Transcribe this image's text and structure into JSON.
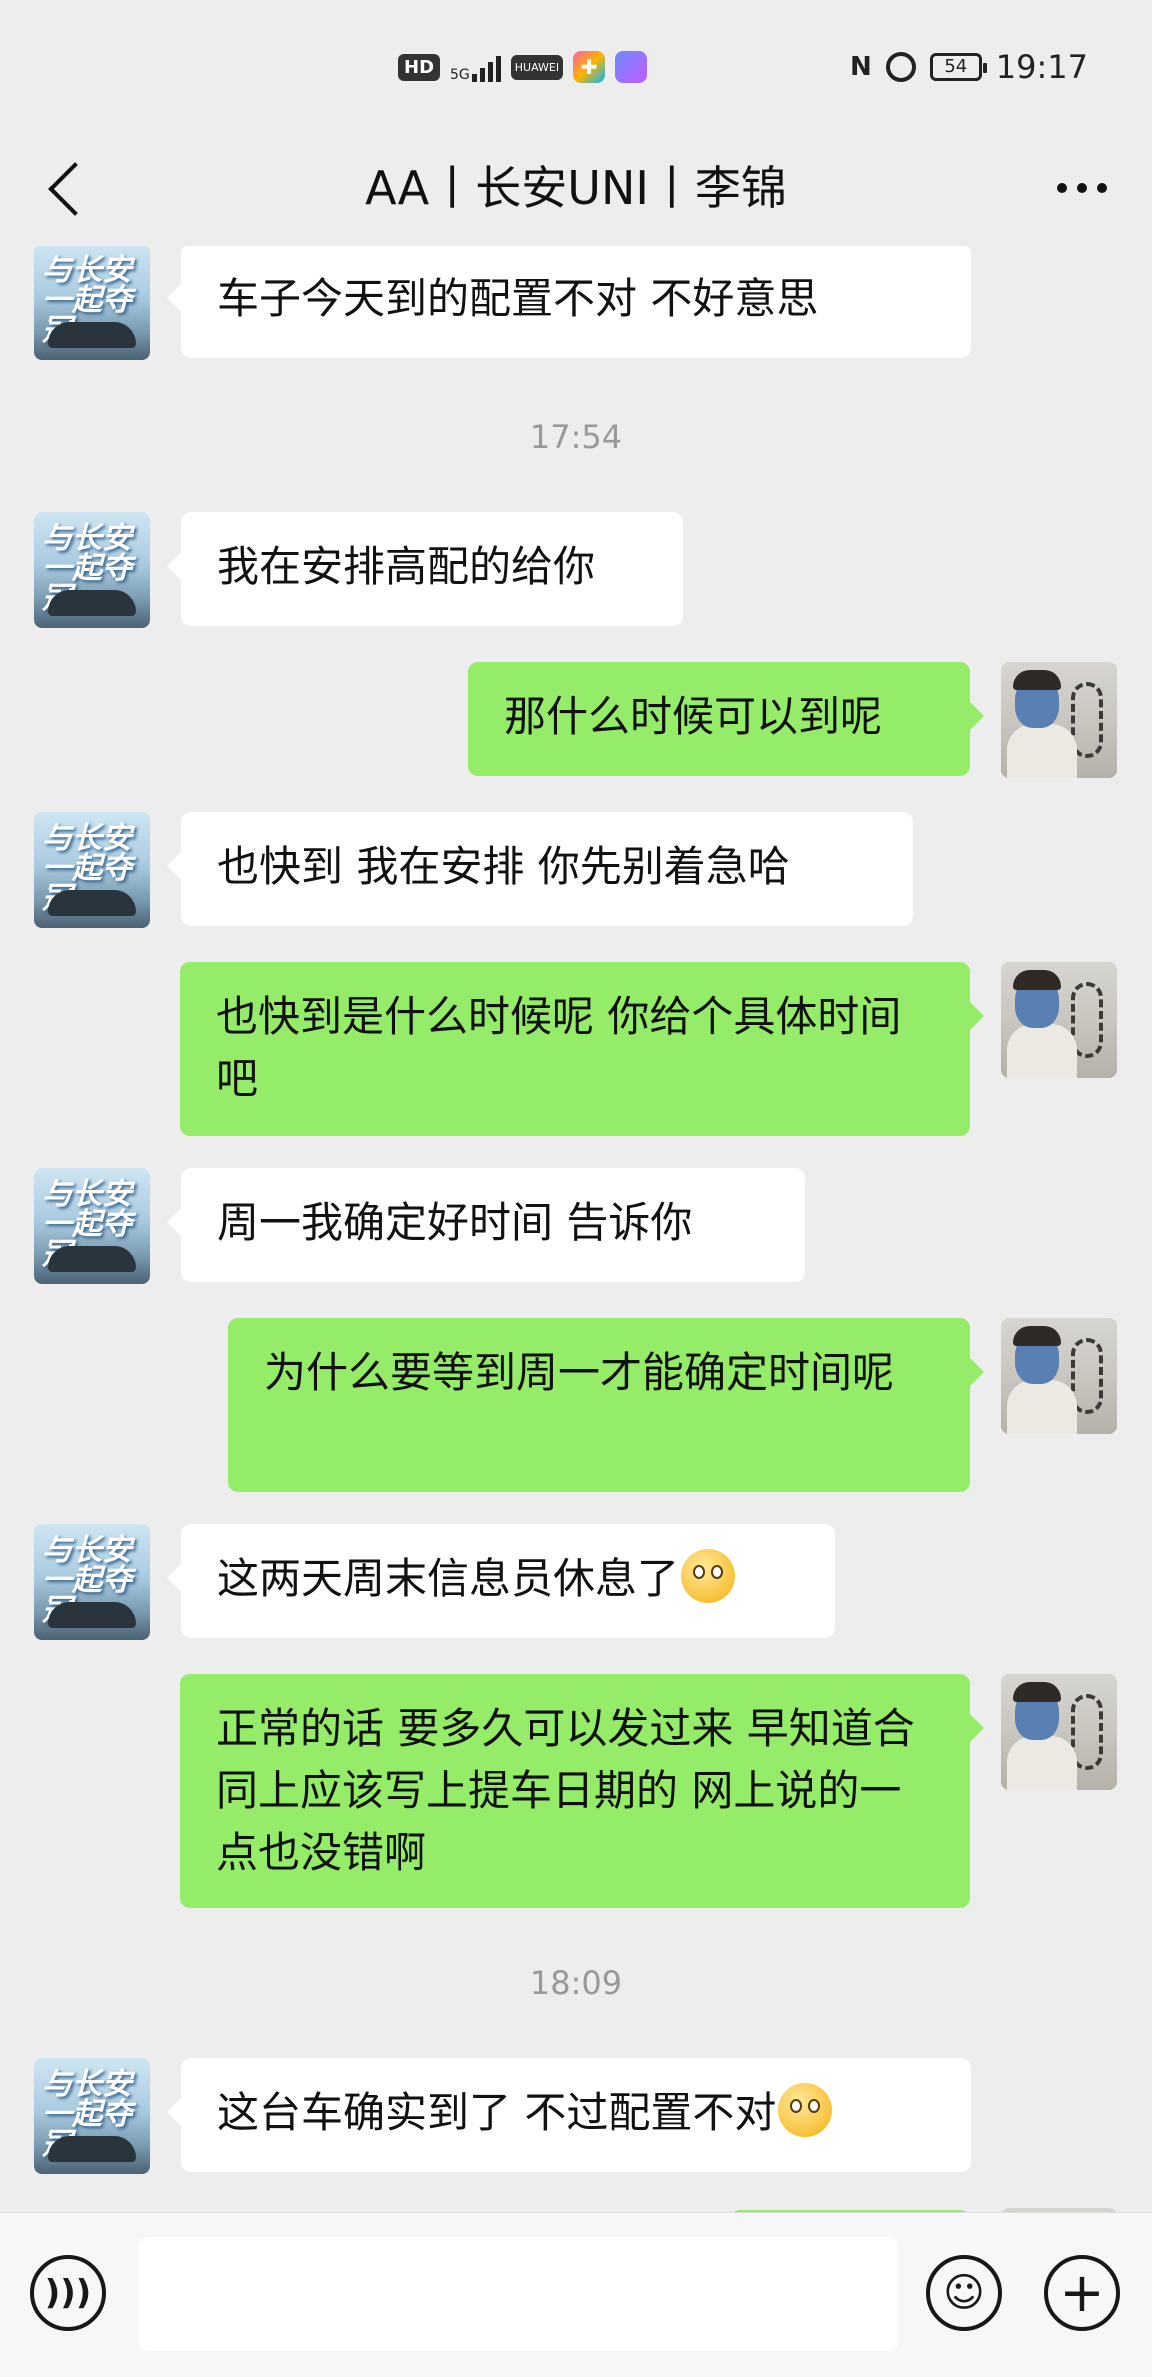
{
  "status_bar": {
    "hd": "HD",
    "network": "5G",
    "brand": "HUAWEI",
    "nfc": "N",
    "battery": "54",
    "time": "19:17"
  },
  "header": {
    "title": "AA丨长安UNI丨李锦",
    "back_icon": "chevron-left-icon",
    "more_icon": "more-dots-icon"
  },
  "avatar_left": {
    "caption": "与长安\n一起夺冠"
  },
  "messages": [
    {
      "type": "msg",
      "side": "left",
      "text": "车子今天到的配置不对  不好意思"
    },
    {
      "type": "time",
      "text": "17:54"
    },
    {
      "type": "msg",
      "side": "left",
      "text": "我在安排高配的给你"
    },
    {
      "type": "msg",
      "side": "right",
      "text": "那什么时候可以到呢"
    },
    {
      "type": "msg",
      "side": "left",
      "text": "也快到  我在安排 你先别着急哈"
    },
    {
      "type": "msg",
      "side": "right",
      "text": "也快到是什么时候呢    你给个具体时间吧"
    },
    {
      "type": "msg",
      "side": "left",
      "text": "周一我确定好时间  告诉你"
    },
    {
      "type": "msg",
      "side": "right",
      "text": "为什么要等到周一才能确定时间呢"
    },
    {
      "type": "msg",
      "side": "left",
      "text": "这两天周末信息员休息了",
      "emoji": "flushed-face-emoji"
    },
    {
      "type": "msg",
      "side": "right",
      "text": "正常的话  要多久可以发过来   早知道合同上应该写上提车日期的    网上说的一点也没错啊"
    },
    {
      "type": "time",
      "text": "18:09"
    },
    {
      "type": "msg",
      "side": "left",
      "text": "这台车确实到了  不过配置不对",
      "emoji": "flushed-face-emoji"
    }
  ],
  "input_bar": {
    "voice_icon": "voice-icon",
    "emoji_icon": "emoji-icon",
    "plus_icon": "plus-icon",
    "input_value": ""
  }
}
